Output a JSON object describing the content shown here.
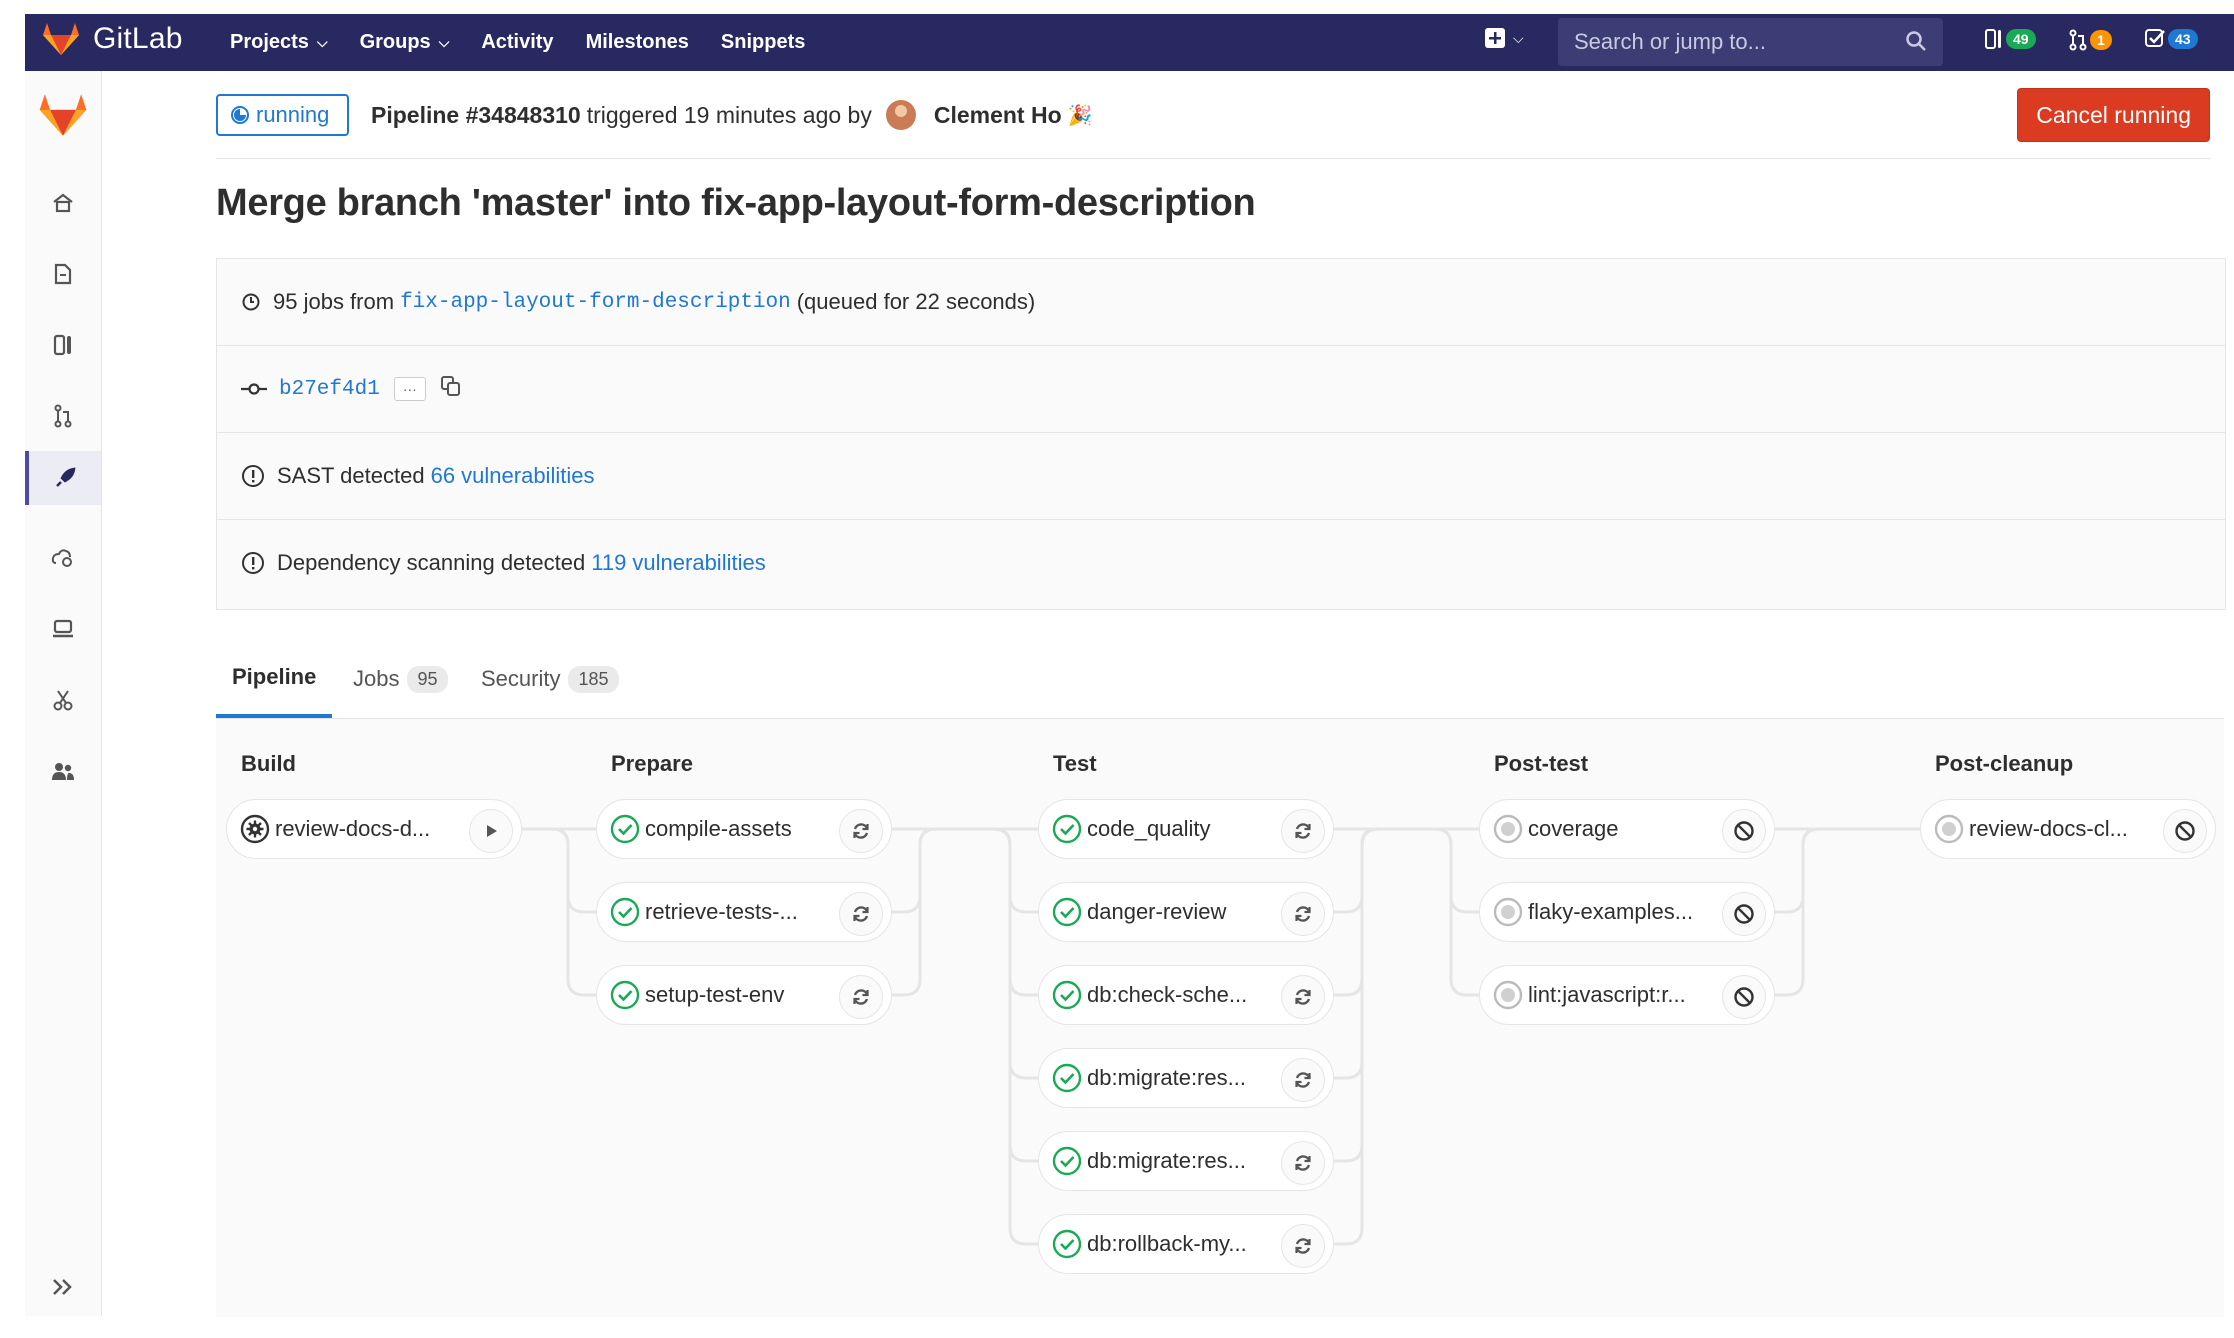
{
  "nav": {
    "brand": "GitLab",
    "items": [
      {
        "label": "Projects",
        "dropdown": true
      },
      {
        "label": "Groups",
        "dropdown": true
      },
      {
        "label": "Activity",
        "dropdown": false
      },
      {
        "label": "Milestones",
        "dropdown": false
      },
      {
        "label": "Snippets",
        "dropdown": false
      }
    ],
    "search_placeholder": "Search or jump to...",
    "counters": [
      {
        "icon": "issues-icon",
        "count": "49",
        "color": "#1aaa55"
      },
      {
        "icon": "merge-request-icon",
        "count": "1",
        "color": "#fc9403"
      },
      {
        "icon": "todo-icon",
        "count": "43",
        "color": "#1f78d1"
      }
    ]
  },
  "sidebar": {
    "items": [
      "home-icon",
      "repository-icon",
      "issues-icon",
      "merge-requests-icon",
      "ci-cd-icon",
      "operations-icon",
      "environments-icon",
      "snippets-icon",
      "members-icon"
    ],
    "active_index": 4
  },
  "header": {
    "status": "running",
    "pipeline_label": "Pipeline #34848310",
    "triggered_text": "triggered 19 minutes ago by",
    "user": "Clement Ho",
    "cancel_label": "Cancel running"
  },
  "title": "Merge branch 'master' into fix-app-layout-form-description",
  "info": {
    "jobs_count_text": "95 jobs from",
    "branch": "fix-app-layout-form-description",
    "queued_text": "(queued for 22 seconds)",
    "commit_sha": "b27ef4d1",
    "ellipsis": "···",
    "sast_text": "SAST detected",
    "sast_link": "66 vulnerabilities",
    "dep_text": "Dependency scanning detected",
    "dep_link": "119 vulnerabilities"
  },
  "tabs": [
    {
      "label": "Pipeline",
      "count": null,
      "active": true
    },
    {
      "label": "Jobs",
      "count": "95",
      "active": false
    },
    {
      "label": "Security",
      "count": "185",
      "active": false
    }
  ],
  "stages": [
    {
      "name": "Build",
      "jobs": [
        {
          "name": "review-docs-d...",
          "status": "manual",
          "action": "play"
        }
      ]
    },
    {
      "name": "Prepare",
      "jobs": [
        {
          "name": "compile-assets",
          "status": "success",
          "action": "retry"
        },
        {
          "name": "retrieve-tests-...",
          "status": "success",
          "action": "retry"
        },
        {
          "name": "setup-test-env",
          "status": "success",
          "action": "retry"
        }
      ]
    },
    {
      "name": "Test",
      "jobs": [
        {
          "name": "code_quality",
          "status": "success",
          "action": "retry"
        },
        {
          "name": "danger-review",
          "status": "success",
          "action": "retry"
        },
        {
          "name": "db:check-sche...",
          "status": "success",
          "action": "retry"
        },
        {
          "name": "db:migrate:res...",
          "status": "success",
          "action": "retry"
        },
        {
          "name": "db:migrate:res...",
          "status": "success",
          "action": "retry"
        },
        {
          "name": "db:rollback-my...",
          "status": "success",
          "action": "retry"
        }
      ]
    },
    {
      "name": "Post-test",
      "jobs": [
        {
          "name": "coverage",
          "status": "created",
          "action": "cancel"
        },
        {
          "name": "flaky-examples...",
          "status": "created",
          "action": "cancel"
        },
        {
          "name": "lint:javascript:r...",
          "status": "created",
          "action": "cancel"
        }
      ]
    },
    {
      "name": "Post-cleanup",
      "jobs": [
        {
          "name": "review-docs-cl...",
          "status": "created",
          "action": "cancel"
        }
      ]
    }
  ]
}
